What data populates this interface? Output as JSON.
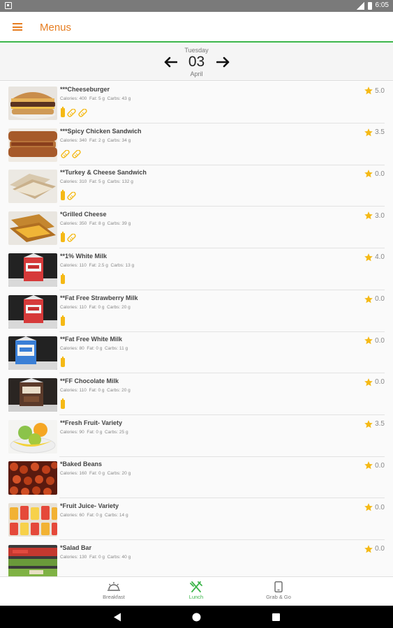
{
  "statusbar": {
    "time": "6:05"
  },
  "appbar": {
    "title": "Menus",
    "menu_icon": "hamburger-menu-icon"
  },
  "date": {
    "day": "Tuesday",
    "number": "03",
    "month": "April"
  },
  "items": [
    {
      "name": "***Cheeseburger",
      "calories": "Calories: 400",
      "fat": "Fat: 5 g",
      "carbs": "Carbs: 43 g",
      "rating": "5.0",
      "icons": [
        "bottle",
        "bread",
        "bread"
      ],
      "photo": "cheeseburger"
    },
    {
      "name": "***Spicy Chicken Sandwich",
      "calories": "Calories: 340",
      "fat": "Fat: 2 g",
      "carbs": "Carbs: 34 g",
      "rating": "3.5",
      "icons": [
        "bread",
        "bread"
      ],
      "photo": "chicken"
    },
    {
      "name": "**Turkey & Cheese Sandwich",
      "calories": "Calories: 310",
      "fat": "Fat: 5 g",
      "carbs": "Carbs: 132 g",
      "rating": "0.0",
      "icons": [
        "bottle",
        "bread"
      ],
      "photo": "turkey"
    },
    {
      "name": "*Grilled Cheese",
      "calories": "Calories: 350",
      "fat": "Fat: 8 g",
      "carbs": "Carbs: 39 g",
      "rating": "3.0",
      "icons": [
        "bottle",
        "bread"
      ],
      "photo": "grilled"
    },
    {
      "name": "**1% White Milk",
      "calories": "Calories: 110",
      "fat": "Fat: 2.5 g",
      "carbs": "Carbs: 13 g",
      "rating": "4.0",
      "icons": [
        "bottle"
      ],
      "photo": "milk-red"
    },
    {
      "name": "**Fat Free Strawberry Milk",
      "calories": "Calories: 110",
      "fat": "Fat: 0 g",
      "carbs": "Carbs: 20 g",
      "rating": "0.0",
      "icons": [
        "bottle"
      ],
      "photo": "milk-red"
    },
    {
      "name": "**Fat Free White Milk",
      "calories": "Calories: 80",
      "fat": "Fat: 0 g",
      "carbs": "Carbs: 11 g",
      "rating": "0.0",
      "icons": [
        "bottle"
      ],
      "photo": "milk-blue"
    },
    {
      "name": "**FF Chocolate Milk",
      "calories": "Calories: 110",
      "fat": "Fat: 0 g",
      "carbs": "Carbs: 20 g",
      "rating": "0.0",
      "icons": [
        "bottle"
      ],
      "photo": "milk-brown"
    },
    {
      "name": "**Fresh Fruit- Variety",
      "calories": "Calories: 90",
      "fat": "Fat: 0 g",
      "carbs": "Carbs: 25 g",
      "rating": "3.5",
      "icons": [],
      "photo": "fruit"
    },
    {
      "name": "*Baked Beans",
      "calories": "Calories: 160",
      "fat": "Fat: 0 g",
      "carbs": "Carbs: 20 g",
      "rating": "0.0",
      "icons": [],
      "photo": "beans"
    },
    {
      "name": "*Fruit Juice- Variety",
      "calories": "Calories: 60",
      "fat": "Fat: 0 g",
      "carbs": "Carbs: 14 g",
      "rating": "0.0",
      "icons": [],
      "photo": "juice"
    },
    {
      "name": "*Salad Bar",
      "calories": "Calories: 130",
      "fat": "Fat: 0 g",
      "carbs": "Carbs: 40 g",
      "rating": "0.0",
      "icons": [],
      "photo": "salad"
    }
  ],
  "tabs": [
    {
      "label": "Breakfast",
      "icon": "sunrise-icon",
      "active": false
    },
    {
      "label": "Lunch",
      "icon": "fork-knife-icon",
      "active": true
    },
    {
      "label": "Grab & Go",
      "icon": "phone-icon",
      "active": false
    }
  ],
  "colors": {
    "accent": "#e67e22",
    "green": "#3cb54a",
    "star": "#f5b915"
  }
}
